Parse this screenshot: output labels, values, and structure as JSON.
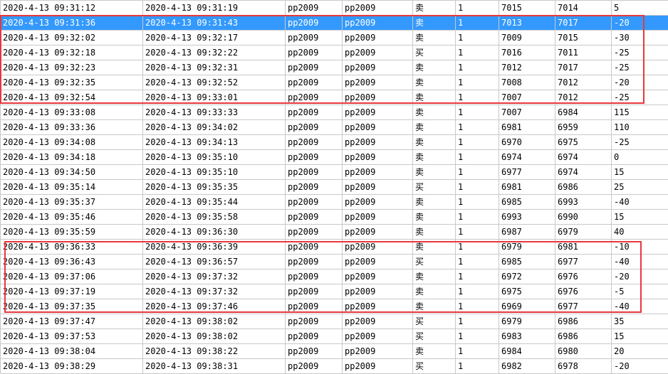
{
  "colors": {
    "selected_row": "#3399ff",
    "highlight_box": "#e8383d",
    "grid_line": "#c9c9c9"
  },
  "selected_row_index": 1,
  "highlight_groups": [
    {
      "rows": [
        1,
        2,
        3,
        4,
        5,
        6
      ]
    },
    {
      "rows": [
        16,
        17,
        18,
        19,
        20
      ]
    }
  ],
  "rows": [
    [
      "2020-4-13 09:31:12",
      "2020-4-13 09:31:19",
      "pp2009",
      "pp2009",
      "卖",
      "1",
      "7015",
      "7014",
      "5"
    ],
    [
      "2020-4-13 09:31:36",
      "2020-4-13 09:31:43",
      "pp2009",
      "pp2009",
      "卖",
      "1",
      "7013",
      "7017",
      "-20"
    ],
    [
      "2020-4-13 09:32:02",
      "2020-4-13 09:32:17",
      "pp2009",
      "pp2009",
      "卖",
      "1",
      "7009",
      "7015",
      "-30"
    ],
    [
      "2020-4-13 09:32:18",
      "2020-4-13 09:32:22",
      "pp2009",
      "pp2009",
      "买",
      "1",
      "7016",
      "7011",
      "-25"
    ],
    [
      "2020-4-13 09:32:23",
      "2020-4-13 09:32:31",
      "pp2009",
      "pp2009",
      "卖",
      "1",
      "7012",
      "7017",
      "-25"
    ],
    [
      "2020-4-13 09:32:35",
      "2020-4-13 09:32:52",
      "pp2009",
      "pp2009",
      "卖",
      "1",
      "7008",
      "7012",
      "-20"
    ],
    [
      "2020-4-13 09:32:54",
      "2020-4-13 09:33:01",
      "pp2009",
      "pp2009",
      "卖",
      "1",
      "7007",
      "7012",
      "-25"
    ],
    [
      "2020-4-13 09:33:08",
      "2020-4-13 09:33:33",
      "pp2009",
      "pp2009",
      "卖",
      "1",
      "7007",
      "6984",
      "115"
    ],
    [
      "2020-4-13 09:33:36",
      "2020-4-13 09:34:02",
      "pp2009",
      "pp2009",
      "卖",
      "1",
      "6981",
      "6959",
      "110"
    ],
    [
      "2020-4-13 09:34:08",
      "2020-4-13 09:34:13",
      "pp2009",
      "pp2009",
      "卖",
      "1",
      "6970",
      "6975",
      "-25"
    ],
    [
      "2020-4-13 09:34:18",
      "2020-4-13 09:35:10",
      "pp2009",
      "pp2009",
      "卖",
      "1",
      "6974",
      "6974",
      "0"
    ],
    [
      "2020-4-13 09:34:50",
      "2020-4-13 09:35:10",
      "pp2009",
      "pp2009",
      "卖",
      "1",
      "6977",
      "6974",
      "15"
    ],
    [
      "2020-4-13 09:35:14",
      "2020-4-13 09:35:35",
      "pp2009",
      "pp2009",
      "买",
      "1",
      "6981",
      "6986",
      "25"
    ],
    [
      "2020-4-13 09:35:37",
      "2020-4-13 09:35:44",
      "pp2009",
      "pp2009",
      "卖",
      "1",
      "6985",
      "6993",
      "-40"
    ],
    [
      "2020-4-13 09:35:46",
      "2020-4-13 09:35:58",
      "pp2009",
      "pp2009",
      "卖",
      "1",
      "6993",
      "6990",
      "15"
    ],
    [
      "2020-4-13 09:35:59",
      "2020-4-13 09:36:30",
      "pp2009",
      "pp2009",
      "卖",
      "1",
      "6987",
      "6979",
      "40"
    ],
    [
      "2020-4-13 09:36:33",
      "2020-4-13 09:36:39",
      "pp2009",
      "pp2009",
      "卖",
      "1",
      "6979",
      "6981",
      "-10"
    ],
    [
      "2020-4-13 09:36:43",
      "2020-4-13 09:36:57",
      "pp2009",
      "pp2009",
      "买",
      "1",
      "6985",
      "6977",
      "-40"
    ],
    [
      "2020-4-13 09:37:06",
      "2020-4-13 09:37:32",
      "pp2009",
      "pp2009",
      "卖",
      "1",
      "6972",
      "6976",
      "-20"
    ],
    [
      "2020-4-13 09:37:19",
      "2020-4-13 09:37:32",
      "pp2009",
      "pp2009",
      "卖",
      "1",
      "6975",
      "6976",
      "-5"
    ],
    [
      "2020-4-13 09:37:35",
      "2020-4-13 09:37:46",
      "pp2009",
      "pp2009",
      "卖",
      "1",
      "6969",
      "6977",
      "-40"
    ],
    [
      "2020-4-13 09:37:47",
      "2020-4-13 09:38:02",
      "pp2009",
      "pp2009",
      "买",
      "1",
      "6979",
      "6986",
      "35"
    ],
    [
      "2020-4-13 09:37:53",
      "2020-4-13 09:38:02",
      "pp2009",
      "pp2009",
      "买",
      "1",
      "6983",
      "6986",
      "15"
    ],
    [
      "2020-4-13 09:38:04",
      "2020-4-13 09:38:22",
      "pp2009",
      "pp2009",
      "卖",
      "1",
      "6984",
      "6980",
      "20"
    ],
    [
      "2020-4-13 09:38:29",
      "2020-4-13 09:38:31",
      "pp2009",
      "pp2009",
      "买",
      "1",
      "6982",
      "6978",
      "-20"
    ]
  ]
}
